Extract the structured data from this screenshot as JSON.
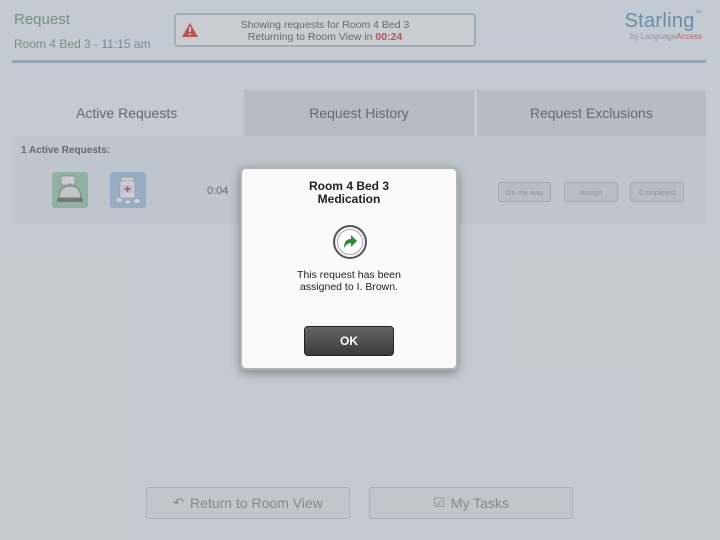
{
  "header": {
    "title": "Request",
    "subtitle": "Room 4 Bed 3 - 11:15 am",
    "notice_line1": "Showing requests for Room 4 Bed 3",
    "notice_line2_prefix": "Returning to Room View in",
    "countdown": "00:24",
    "notice_icon": "warning-icon",
    "brand_name": "Starling",
    "brand_tm": "™",
    "brand_by": "by",
    "brand_company_a": "Language",
    "brand_company_b": "Access"
  },
  "tabs": [
    {
      "label": "Active Requests",
      "active": true
    },
    {
      "label": "Request History",
      "active": false
    },
    {
      "label": "Request Exclusions",
      "active": false
    }
  ],
  "active_requests": {
    "count_label": "1 Active Requests:",
    "items": [
      {
        "icons": [
          "service-bell-icon",
          "medication-icon"
        ],
        "elapsed": "0:04",
        "actions": [
          "On my way",
          "Assign",
          "Completed"
        ]
      }
    ]
  },
  "footer": {
    "return_label": "Return to Room View",
    "return_icon": "return-arrow-icon",
    "tasks_label": "My Tasks",
    "tasks_icon": "checkbox-icon"
  },
  "modal": {
    "title_line1": "Room 4 Bed 3",
    "title_line2": "Medication",
    "icon": "assign-arrow-icon",
    "message_line1": "This request has been",
    "message_line2": "assigned to I. Brown.",
    "ok_label": "OK"
  },
  "colors": {
    "header_green": "#6f9579",
    "brand_blue": "#5e8fb3",
    "countdown_red": "#d9342b",
    "assign_green": "#2e8b3a"
  }
}
